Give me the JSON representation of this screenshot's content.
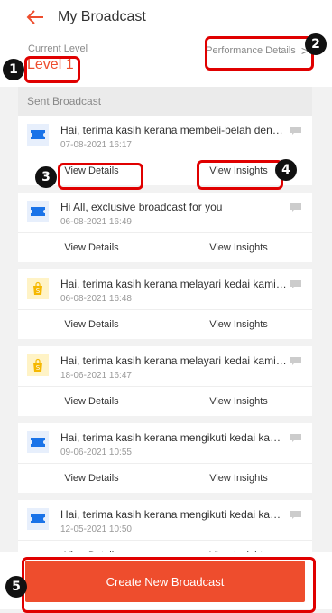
{
  "header": {
    "title": "My Broadcast"
  },
  "level": {
    "label": "Current Level",
    "value": "Level 1",
    "performance_link": "Performance Details",
    "chevron": ">"
  },
  "section": {
    "title": "Sent Broadcast"
  },
  "actions": {
    "view_details": "View Details",
    "view_insights": "View Insights"
  },
  "broadcasts": [
    {
      "icon": "ticket-icon",
      "message": "Hai, terima kasih kerana membeli-belah dengan ka...",
      "date": "07-08-2021 16:17"
    },
    {
      "icon": "ticket-icon",
      "message": "Hi All, exclusive broadcast for you",
      "date": "06-08-2021 16:49"
    },
    {
      "icon": "shop-icon",
      "message": "Hai, terima kasih kerana melayari kedai kami! Kam...",
      "date": "06-08-2021 16:48"
    },
    {
      "icon": "shop-icon",
      "message": "Hai, terima kasih kerana melayari kedai kami! Kam...",
      "date": "18-06-2021 16:47"
    },
    {
      "icon": "ticket-icon",
      "message": "Hai, terima kasih kerana mengikuti kedai kami! Ter...",
      "date": "09-06-2021 10:55"
    },
    {
      "icon": "ticket-icon",
      "message": "Hai, terima kasih kerana mengikuti kedai kami! Ini...",
      "date": "12-05-2021 10:50"
    }
  ],
  "create_button": {
    "label": "Create New Broadcast"
  },
  "annotations": [
    "1",
    "2",
    "3",
    "4",
    "5"
  ],
  "colors": {
    "accent": "#ee4d2d",
    "highlight": "#e00000",
    "ticket": "#1a73e8",
    "shop": "#f5b800"
  }
}
